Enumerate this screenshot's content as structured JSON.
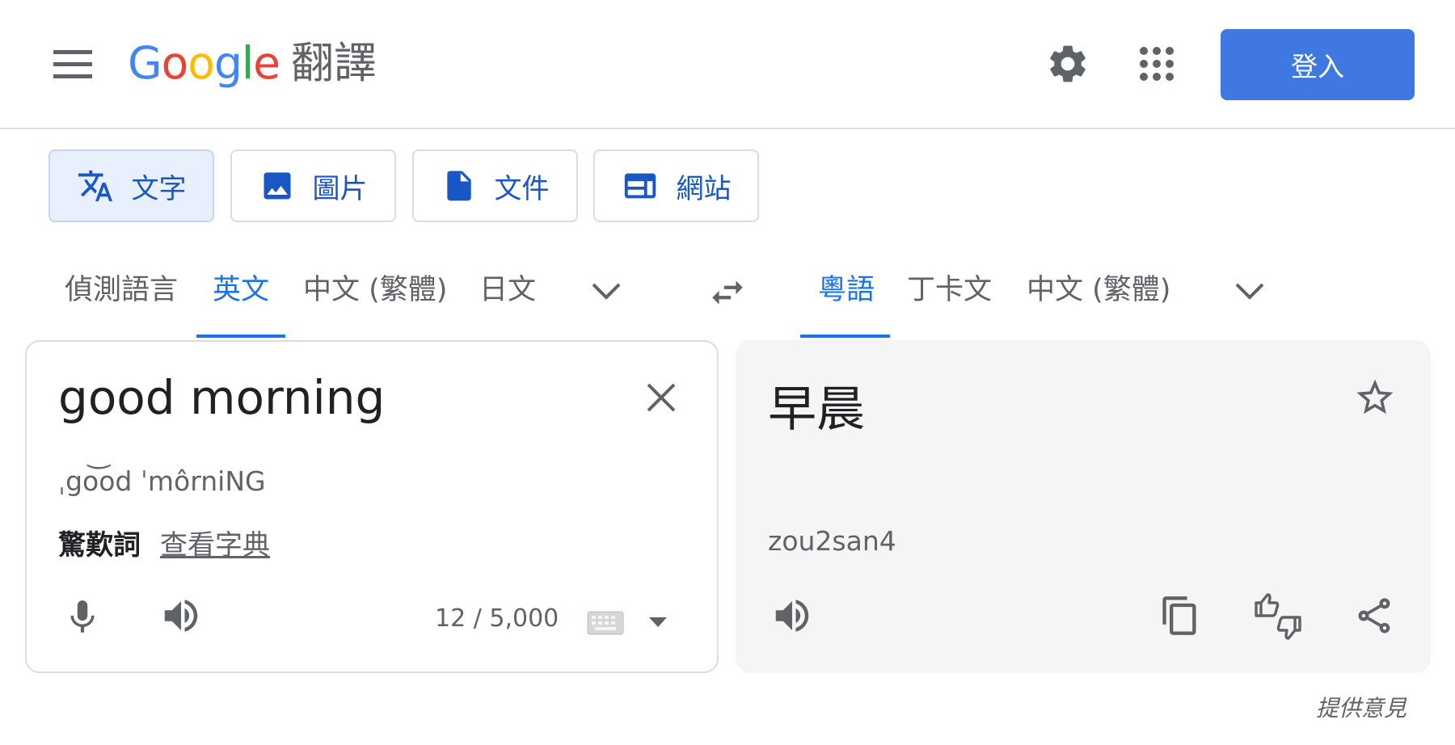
{
  "header": {
    "logo_brand": "Google",
    "logo_product": "翻譯",
    "sign_in_label": "登入"
  },
  "mode_tabs": [
    {
      "label": "文字",
      "icon": "translate-icon",
      "active": true
    },
    {
      "label": "圖片",
      "icon": "image-icon",
      "active": false
    },
    {
      "label": "文件",
      "icon": "document-icon",
      "active": false
    },
    {
      "label": "網站",
      "icon": "website-icon",
      "active": false
    }
  ],
  "source_languages": [
    {
      "label": "偵測語言",
      "active": false
    },
    {
      "label": "英文",
      "active": true
    },
    {
      "label": "中文 (繁體)",
      "active": false
    },
    {
      "label": "日文",
      "active": false
    }
  ],
  "target_languages": [
    {
      "label": "粵語",
      "active": true
    },
    {
      "label": "丁卡文",
      "active": false
    },
    {
      "label": "中文 (繁體)",
      "active": false
    }
  ],
  "source": {
    "text": "good morning",
    "phonetic": "ˌgo͝od ˈmôrniNG",
    "part_of_speech": "驚歎詞",
    "dictionary_link": "查看字典",
    "char_count": "12 / 5,000"
  },
  "target": {
    "text": "早晨",
    "romanization": "zou2san4"
  },
  "feedback_label": "提供意見",
  "colors": {
    "accent_blue": "#1a73e8",
    "sign_in_blue": "#3e78e0",
    "icon_gray": "#5f6368",
    "target_panel_bg": "#f5f5f5",
    "google_blue": "#4285f4",
    "google_red": "#ea4335",
    "google_yellow": "#fbbc05",
    "google_green": "#34a853"
  }
}
